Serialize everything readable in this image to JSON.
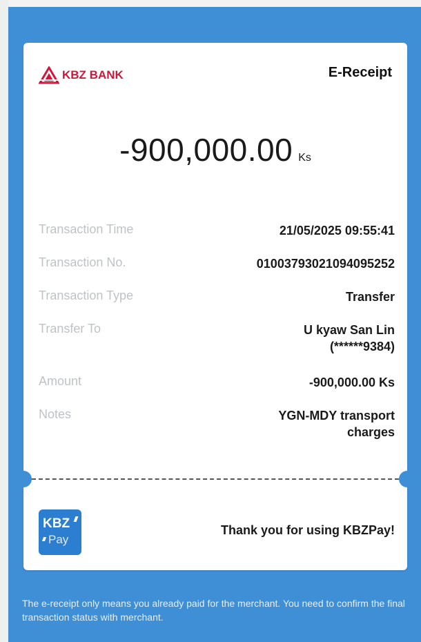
{
  "header": {
    "bank_name": "KBZ BANK",
    "title": "E-Receipt"
  },
  "amount": {
    "value": "-900,000.00",
    "unit": "Ks"
  },
  "details": [
    {
      "label": "Transaction Time",
      "value": "21/05/2025 09:55:41"
    },
    {
      "label": "Transaction No.",
      "value": "01003793021094095252"
    },
    {
      "label": "Transaction Type",
      "value": "Transfer"
    },
    {
      "label": "Transfer To",
      "value_line1": "U kyaw San Lin",
      "value_line2": "(******9384)"
    },
    {
      "label": "Amount",
      "value": "-900,000.00 Ks"
    },
    {
      "label": "Notes",
      "value_line1": "YGN-MDY transport",
      "value_line2": "charges"
    }
  ],
  "footer": {
    "logo_top": "KBZ",
    "logo_bottom": "Pay",
    "thank_you": "Thank you for using KBZPay!"
  },
  "disclaimer": "The e-receipt only means you already paid for the merchant. You need to confirm the final transaction status with merchant.",
  "colors": {
    "background_blue": "#3f8fd6",
    "brand_red": "#d2163a",
    "label_gray": "#bfc3c6"
  }
}
